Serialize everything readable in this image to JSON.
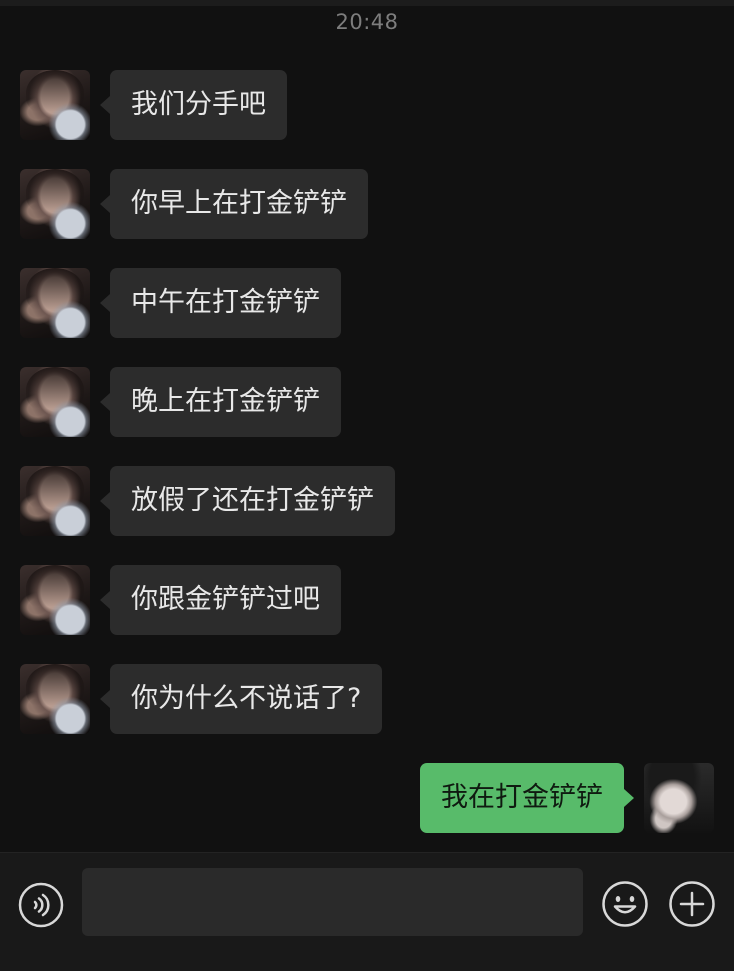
{
  "chat": {
    "timestamp": "20:48",
    "messages": [
      {
        "sender": "other",
        "text": "我们分手吧"
      },
      {
        "sender": "other",
        "text": "你早上在打金铲铲"
      },
      {
        "sender": "other",
        "text": "中午在打金铲铲"
      },
      {
        "sender": "other",
        "text": "晚上在打金铲铲"
      },
      {
        "sender": "other",
        "text": "放假了还在打金铲铲"
      },
      {
        "sender": "other",
        "text": "你跟金铲铲过吧"
      },
      {
        "sender": "other",
        "text": "你为什么不说话了?"
      },
      {
        "sender": "me",
        "text": "我在打金铲铲"
      }
    ]
  },
  "input_bar": {
    "text_value": "",
    "icons": {
      "voice": "voice-icon",
      "emoji": "emoji-icon",
      "more": "plus-icon"
    }
  },
  "colors": {
    "background": "#111111",
    "incoming_bubble": "#2c2c2c",
    "outgoing_bubble": "#58bb6a",
    "timestamp": "#7d7d7d"
  }
}
